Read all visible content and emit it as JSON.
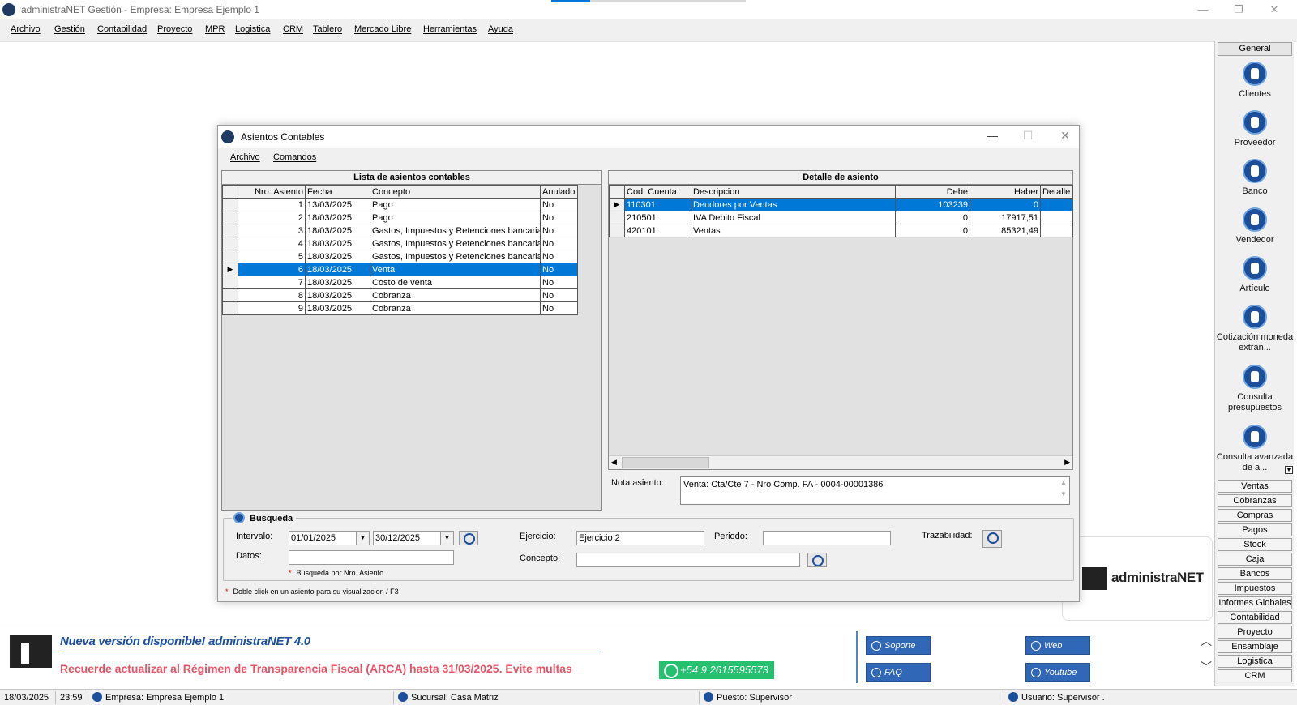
{
  "app": {
    "title": "administraNET Gestión - Empresa: Empresa Ejemplo 1",
    "minimize": "—",
    "restore": "❐",
    "close": "✕"
  },
  "menu": [
    "Archivo",
    "Gestión",
    "Contabilidad",
    "Proyecto",
    "MPR",
    "Logistica",
    "CRM",
    "Tablero",
    "Mercado Libre",
    "Herramientas",
    "Ayuda"
  ],
  "sidebar": {
    "header": "General",
    "items": [
      "Clientes",
      "Proveedor",
      "Banco",
      "Vendedor",
      "Artículo",
      "Cotización moneda extran...",
      "Consulta presupuestos",
      "Consulta avanzada de a..."
    ],
    "buttons": [
      "Ventas",
      "Cobranzas",
      "Compras",
      "Pagos",
      "Stock",
      "Caja",
      "Bancos",
      "Impuestos",
      "Informes Globales",
      "Contabilidad",
      "Proyecto",
      "Ensamblaje",
      "Logistica",
      "CRM"
    ]
  },
  "dialog": {
    "title": "Asientos Contables",
    "menu": [
      "Archivo",
      "Comandos"
    ],
    "lista": {
      "caption": "Lista de asientos contables",
      "columns": [
        "Nro. Asiento",
        "Fecha",
        "Concepto",
        "Anulado"
      ],
      "rows": [
        [
          "1",
          "13/03/2025",
          "Pago",
          "No"
        ],
        [
          "2",
          "18/03/2025",
          "Pago",
          "No"
        ],
        [
          "3",
          "18/03/2025",
          "Gastos, Impuestos y Retenciones bancarias",
          "No"
        ],
        [
          "4",
          "18/03/2025",
          "Gastos, Impuestos y Retenciones bancarias",
          "No"
        ],
        [
          "5",
          "18/03/2025",
          "Gastos, Impuestos y Retenciones bancarias",
          "No"
        ],
        [
          "6",
          "18/03/2025",
          "Venta",
          "No"
        ],
        [
          "7",
          "18/03/2025",
          "Costo de venta",
          "No"
        ],
        [
          "8",
          "18/03/2025",
          "Cobranza",
          "No"
        ],
        [
          "9",
          "18/03/2025",
          "Cobranza",
          "No"
        ]
      ],
      "selected_row": 5
    },
    "detalle": {
      "caption": "Detalle de asiento",
      "columns": [
        "Cod. Cuenta",
        "Descripcion",
        "Debe",
        "Haber",
        "Detalle"
      ],
      "rows": [
        [
          "110301",
          "Deudores por Ventas",
          "103239",
          "0",
          ""
        ],
        [
          "210501",
          "IVA Debito Fiscal",
          "0",
          "17917,51",
          ""
        ],
        [
          "420101",
          "Ventas",
          "0",
          "85321,49",
          ""
        ]
      ],
      "selected_row": 0
    },
    "nota_label": "Nota asiento:",
    "nota_value": "Venta: Cta/Cte 7 - Nro Comp.  FA - 0004-00001386",
    "busqueda": {
      "legend": "Busqueda",
      "intervalo_label": "Intervalo:",
      "desde": "01/01/2025",
      "hasta": "30/12/2025",
      "datos_label": "Datos:",
      "datos_value": "",
      "nota_busqueda": "Busqueda por Nro. Asiento",
      "ejercicio_label": "Ejercicio:",
      "ejercicio_value": "Ejercicio 2",
      "periodo_label": "Periodo:",
      "periodo_value": "",
      "concepto_label": "Concepto:",
      "concepto_value": "",
      "trazabilidad_label": "Trazabilidad:"
    },
    "footer_note": "Doble click en un asiento para su visualizacion / F3"
  },
  "brand": "administraNET",
  "banner": {
    "headline": "Nueva versión disponible! administraNET 4.0",
    "alert": "Recuerde actualizar al Régimen de Transparencia Fiscal (ARCA) hasta 31/03/2025. Evite multas",
    "whatsapp": "+54 9 2615595573",
    "links": [
      "Soporte",
      "Web",
      "FAQ",
      "Youtube"
    ]
  },
  "status": {
    "date": "18/03/2025",
    "time": "23:59",
    "empresa": "Empresa: Empresa Ejemplo 1",
    "sucursal": "Sucursal: Casa Matriz",
    "puesto": "Puesto: Supervisor",
    "usuario": "Usuario: Supervisor ."
  }
}
